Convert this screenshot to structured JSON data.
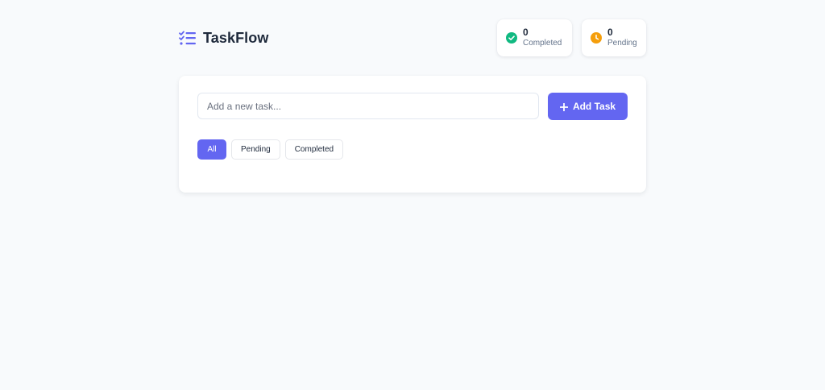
{
  "app": {
    "title": "TaskFlow",
    "brand_color": "#6366f1"
  },
  "stats": {
    "completed": {
      "count": "0",
      "label": "Completed",
      "icon": "check-circle-icon",
      "color": "#10b981"
    },
    "pending": {
      "count": "0",
      "label": "Pending",
      "icon": "clock-icon",
      "color": "#f59e0b"
    }
  },
  "task_form": {
    "input_value": "",
    "placeholder": "Add a new task...",
    "add_label": "Add Task",
    "add_icon": "plus-icon"
  },
  "filters": {
    "active": "All",
    "items": [
      "All",
      "Pending",
      "Completed"
    ]
  }
}
